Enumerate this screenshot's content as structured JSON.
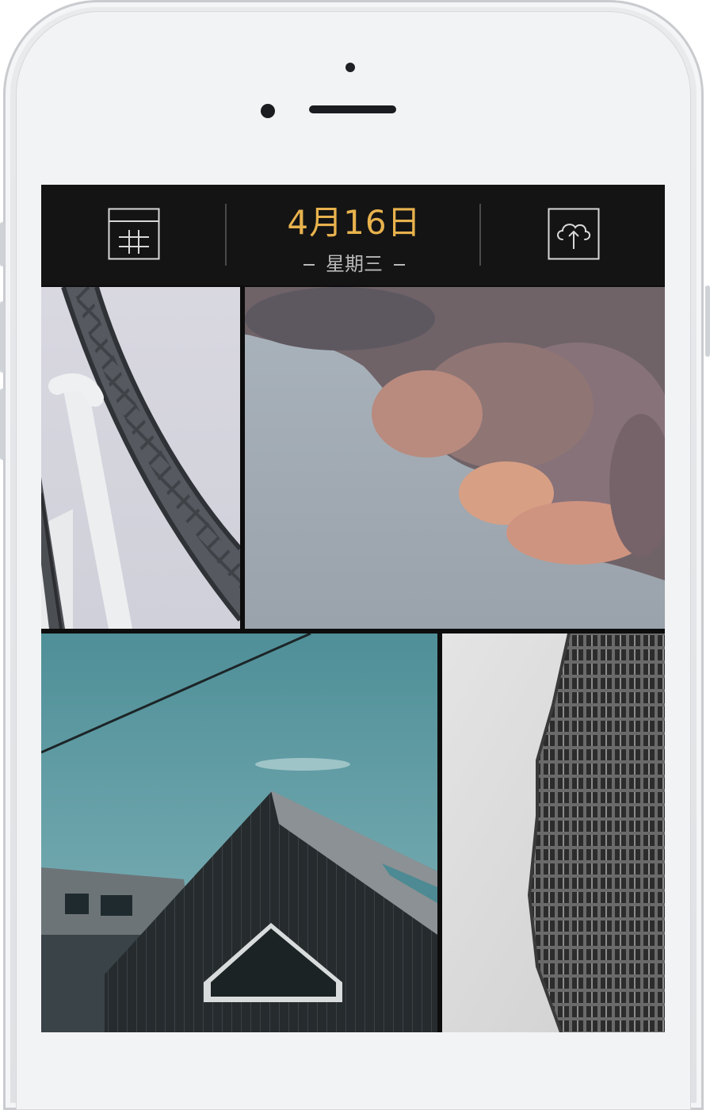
{
  "header": {
    "date": "4月16日",
    "weekday": "星期三",
    "left_icon": "grid-calendar-icon",
    "right_icon": "cloud-upload-icon",
    "accent_color": "#e8b24d"
  },
  "photos": [
    {
      "subject": "roller-coaster-photo"
    },
    {
      "subject": "cloud-photo"
    },
    {
      "subject": "house-photo"
    },
    {
      "subject": "skyscraper-photo"
    }
  ]
}
